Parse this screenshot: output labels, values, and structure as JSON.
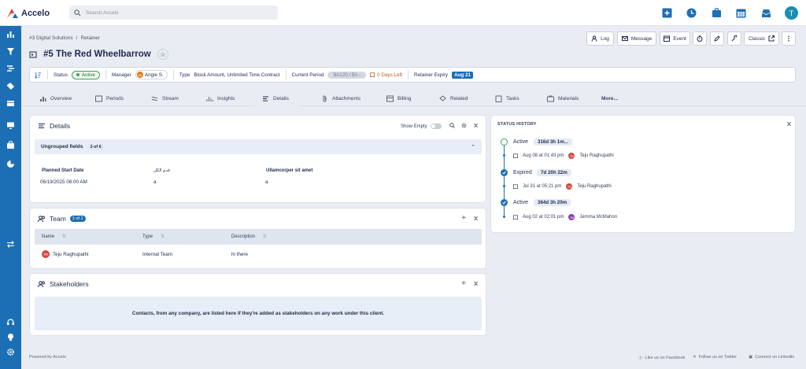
{
  "app": {
    "name": "Accelo"
  },
  "search": {
    "placeholder": "Search Accelo"
  },
  "user": {
    "initial": "T"
  },
  "breadcrumb": {
    "root": "#3 Digital Solutions",
    "sep": "/",
    "current": "Retainer"
  },
  "page": {
    "title": "#5 The Red Wheelbarrow"
  },
  "actions": {
    "log": "Log",
    "message": "Message",
    "event": "Event",
    "classic": "Classic"
  },
  "statusbar": {
    "status_label": "Status",
    "status_value": "Active",
    "manager_label": "Manager",
    "manager_value": "Angie S.",
    "manager_initials": "AS",
    "type_label": "Type",
    "type_value": "Block Amount, Unlimited Time Contract",
    "period_label": "Current Period",
    "period_amount": "$A120 / $A -",
    "period_days": "0 Days Left",
    "expiry_label": "Retainer Expiry",
    "expiry_value": "Aug 21"
  },
  "tabs": [
    "Overview",
    "Periods",
    "Stream",
    "Insights",
    "Details",
    "Attachments",
    "Billing",
    "Related",
    "Tasks",
    "Materials",
    "More..."
  ],
  "details": {
    "title": "Details",
    "show_empty": "Show Empty",
    "group_title": "Ungrouped fields",
    "group_count": "3 of 6",
    "fields": [
      {
        "label": "Planned Start Date",
        "value": "06/19/2025 08:00 AM"
      },
      {
        "label": "قدم الكل",
        "value": "a"
      },
      {
        "label": "Ullamcorper sit amet",
        "value": "a"
      }
    ]
  },
  "team": {
    "title": "Team",
    "count": "1 of 1",
    "columns": [
      "Name",
      "Type",
      "Description"
    ],
    "rows": [
      {
        "initials": "TR",
        "name": "Teju Raghupathi",
        "type": "Internal Team",
        "description": "hi there"
      }
    ]
  },
  "stakeholders": {
    "title": "Stakeholders",
    "empty_text": "Contacts, from any company, are listed here if they're added as stakeholders on any work under this client."
  },
  "status_history": {
    "title": "STATUS HISTORY",
    "entries": [
      {
        "state": "Active",
        "duration": "316d 3h 1m...",
        "date": "Aug 08 at 01:43 pm",
        "user": "Teju Raghupathi",
        "initials": "TR"
      },
      {
        "state": "Expired",
        "duration": "7d 20h 22m",
        "date": "Jul 31 at 05:21 pm",
        "user": "Teju Raghupathi",
        "initials": "TR"
      },
      {
        "state": "Active",
        "duration": "364d 3h 20m",
        "date": "Aug 02 at 02:01 pm",
        "user": "Jemma McMahon",
        "initials": "JM"
      }
    ]
  },
  "footer": {
    "powered": "Powered by Accelo",
    "facebook": "Like us on Facebook",
    "twitter": "Follow us on Twitter",
    "linkedin": "Connect on Linkedin"
  },
  "colors": {
    "brand": "#1c6fb5",
    "active": "#3aa05a",
    "danger": "#d04a3b"
  }
}
